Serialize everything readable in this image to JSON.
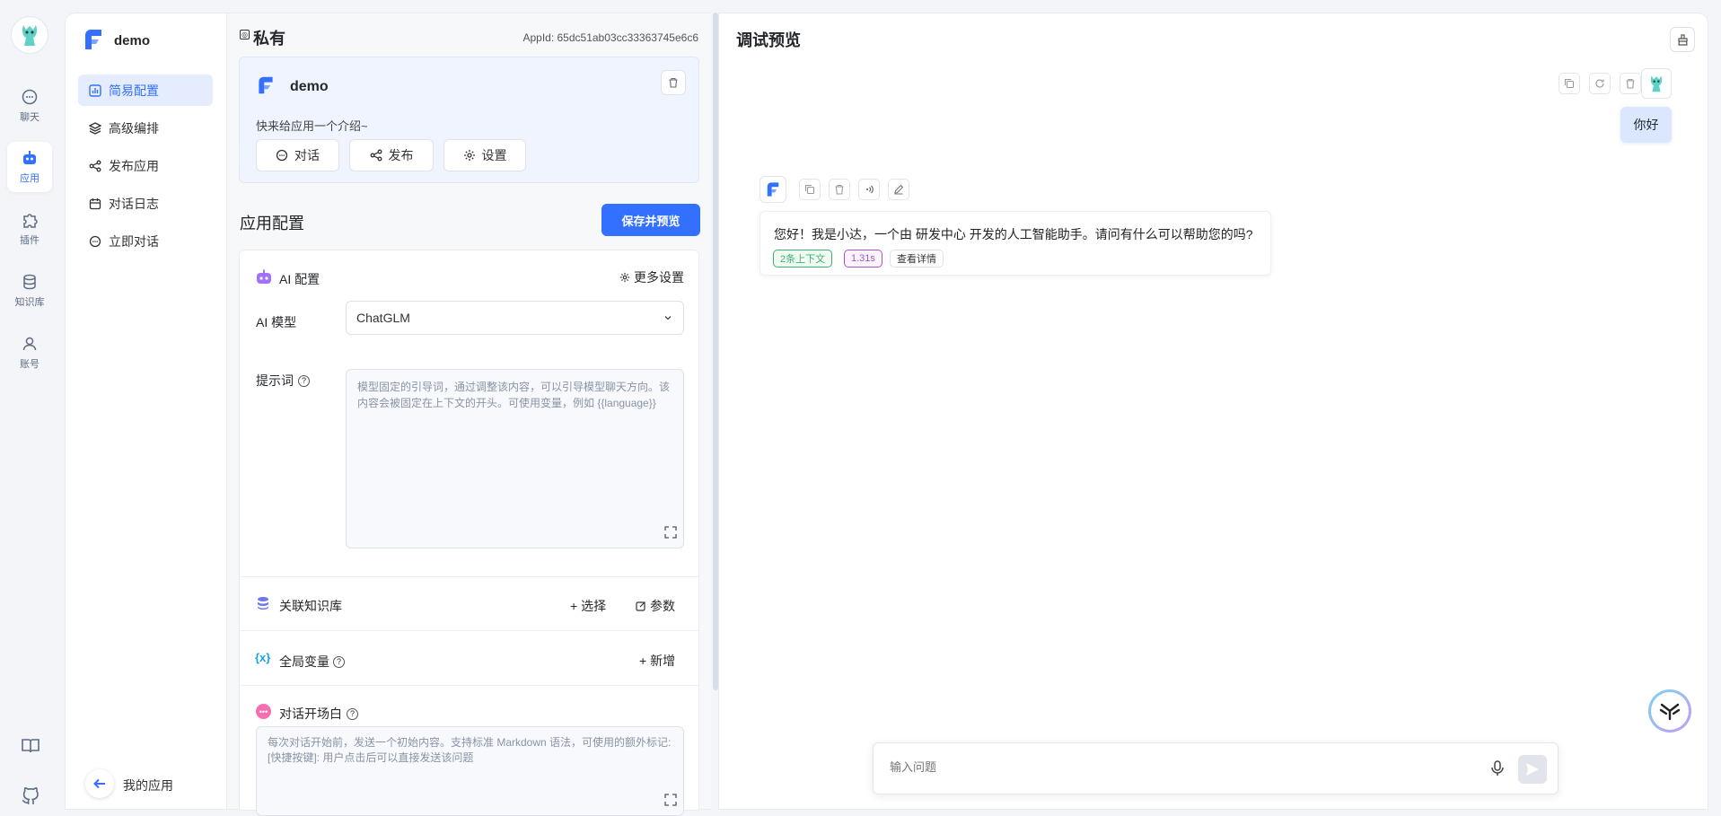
{
  "rail": {
    "items": [
      {
        "label": "聊天",
        "icon": "chat-icon"
      },
      {
        "label": "应用",
        "icon": "robot-icon"
      },
      {
        "label": "插件",
        "icon": "puzzle-icon"
      },
      {
        "label": "知识库",
        "icon": "database-icon"
      },
      {
        "label": "账号",
        "icon": "user-icon"
      }
    ],
    "bottom_icons": [
      "book-icon",
      "github-icon"
    ]
  },
  "sidebar": {
    "app_name": "demo",
    "items": [
      {
        "label": "简易配置",
        "icon": "chart-icon",
        "active": true
      },
      {
        "label": "高级编排",
        "icon": "layers-icon"
      },
      {
        "label": "发布应用",
        "icon": "share-icon"
      },
      {
        "label": "对话日志",
        "icon": "calendar-icon"
      },
      {
        "label": "立即对话",
        "icon": "chat-icon"
      }
    ],
    "back_label": "我的应用"
  },
  "header": {
    "visibility": "私有",
    "app_id": "AppId: 65dc51ab03cc33363745e6c6"
  },
  "app_card": {
    "name": "demo",
    "intro": "快来给应用一个介绍~",
    "buttons": {
      "chat": "对话",
      "publish": "发布",
      "settings": "设置"
    }
  },
  "config": {
    "title": "应用配置",
    "save_label": "保存并预览",
    "ai": {
      "title": "AI 配置",
      "more_settings": "更多设置",
      "model_label": "AI 模型",
      "model_value": "ChatGLM",
      "prompt_label": "提示词",
      "prompt_placeholder": "模型固定的引导词，通过调整该内容，可以引导模型聊天方向。该内容会被固定在上下文的开头。可使用变量，例如 {{language}}"
    },
    "kb": {
      "title": "关联知识库",
      "select": "+ 选择",
      "params": "参数"
    },
    "vars": {
      "title": "全局变量",
      "add": "+ 新增"
    },
    "welcome": {
      "title": "对话开场白",
      "placeholder": "每次对话开始前，发送一个初始内容。支持标准 Markdown 语法，可使用的额外标记: [快捷按键]: 用户点击后可以直接发送该问题"
    }
  },
  "preview": {
    "title": "调试预览",
    "user_message": "你好",
    "bot_message": "您好！我是小达，一个由 研发中心 开发的人工智能助手。请问有什么可以帮助您的吗?",
    "tags": {
      "context": "2条上下文",
      "time": "1.31s",
      "detail": "查看详情"
    },
    "input_placeholder": "输入问题"
  },
  "colors": {
    "accent": "#3370ff",
    "green": "#3bb46c",
    "purple": "#a855c7"
  }
}
